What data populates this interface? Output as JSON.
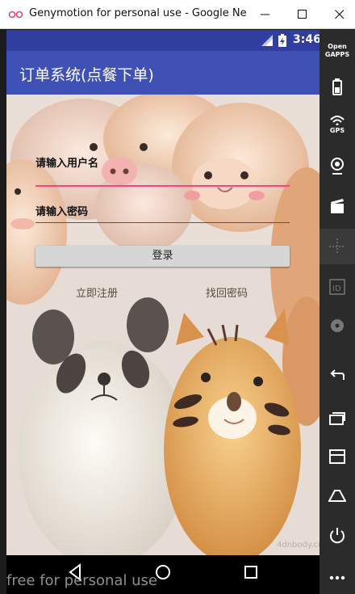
{
  "window": {
    "title": "Genymotion for personal use - Google Nexu..."
  },
  "statusbar": {
    "time": "3:46"
  },
  "app": {
    "title": "订单系统(点餐下单)",
    "username_hint": "请输入用户名",
    "password_hint": "请输入密码",
    "login_label": "登录",
    "register_link": "立即注册",
    "forgot_link": "找回密码"
  },
  "sidebar": {
    "opengapps_label_1": "Open",
    "opengapps_label_2": "GAPPS",
    "gps_label": "GPS"
  },
  "watermark": "free for personal use",
  "colors": {
    "statusbar": "#303f9f",
    "toolbar": "#3f51b5",
    "accent": "#ff4081"
  }
}
